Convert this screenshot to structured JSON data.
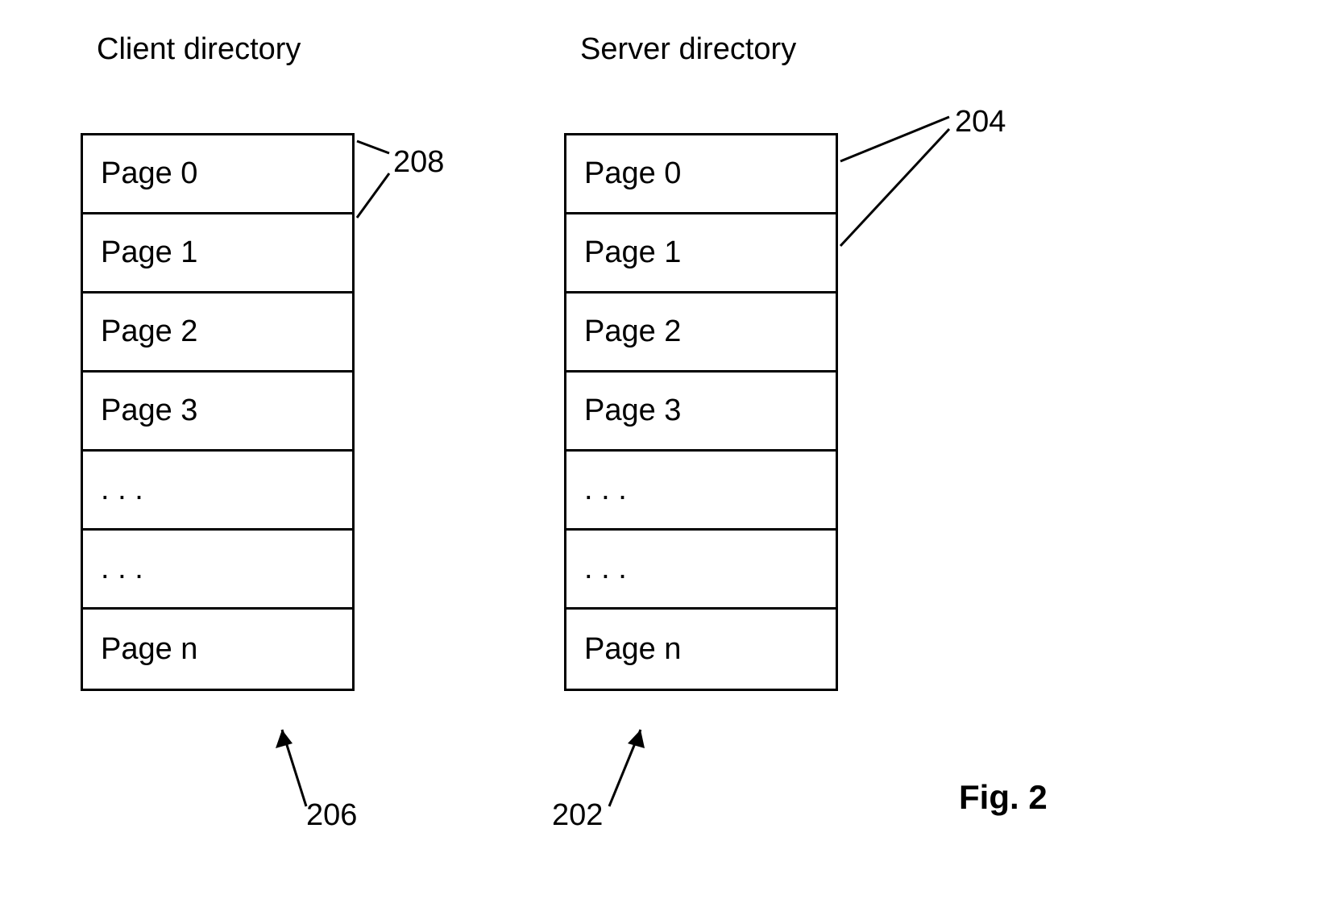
{
  "titles": {
    "client": "Client directory",
    "server": "Server directory"
  },
  "clientDirectory": {
    "pages": [
      "Page 0",
      "Page 1",
      "Page 2",
      "Page 3",
      ".  .  .",
      ".  .  .",
      "Page n"
    ]
  },
  "serverDirectory": {
    "pages": [
      "Page 0",
      "Page 1",
      "Page 2",
      "Page 3",
      ".  .  .",
      ".  .  .",
      "Page n"
    ]
  },
  "refs": {
    "r208": "208",
    "r204": "204",
    "r206": "206",
    "r202": "202"
  },
  "figure": "Fig. 2"
}
